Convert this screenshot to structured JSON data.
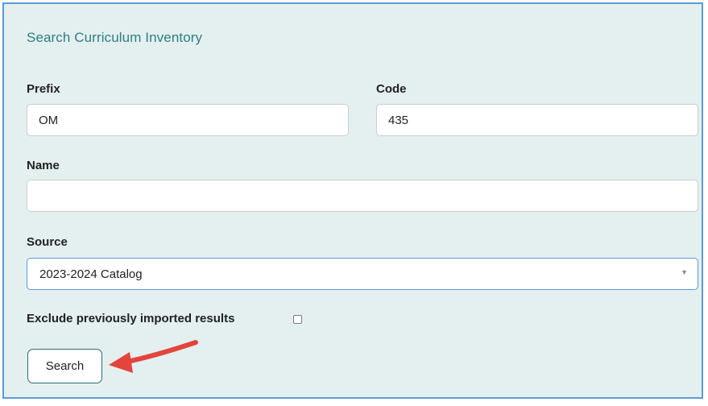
{
  "panel": {
    "title": "Search Curriculum Inventory"
  },
  "form": {
    "prefix": {
      "label": "Prefix",
      "value": "OM"
    },
    "code": {
      "label": "Code",
      "value": "435"
    },
    "name": {
      "label": "Name",
      "value": ""
    },
    "source": {
      "label": "Source",
      "selected": "2023-2024 Catalog"
    },
    "exclude": {
      "label": "Exclude previously imported results",
      "checked": false
    },
    "search_label": "Search"
  },
  "icons": {
    "annotation_arrow": "red-arrow-icon",
    "select_caret": "chevron-down-icon"
  },
  "colors": {
    "panel_bg": "#e4eff0",
    "panel_border": "#5b9bd5",
    "title": "#2e7f80",
    "arrow": "#e3443c",
    "button_border": "#2e6e70"
  }
}
